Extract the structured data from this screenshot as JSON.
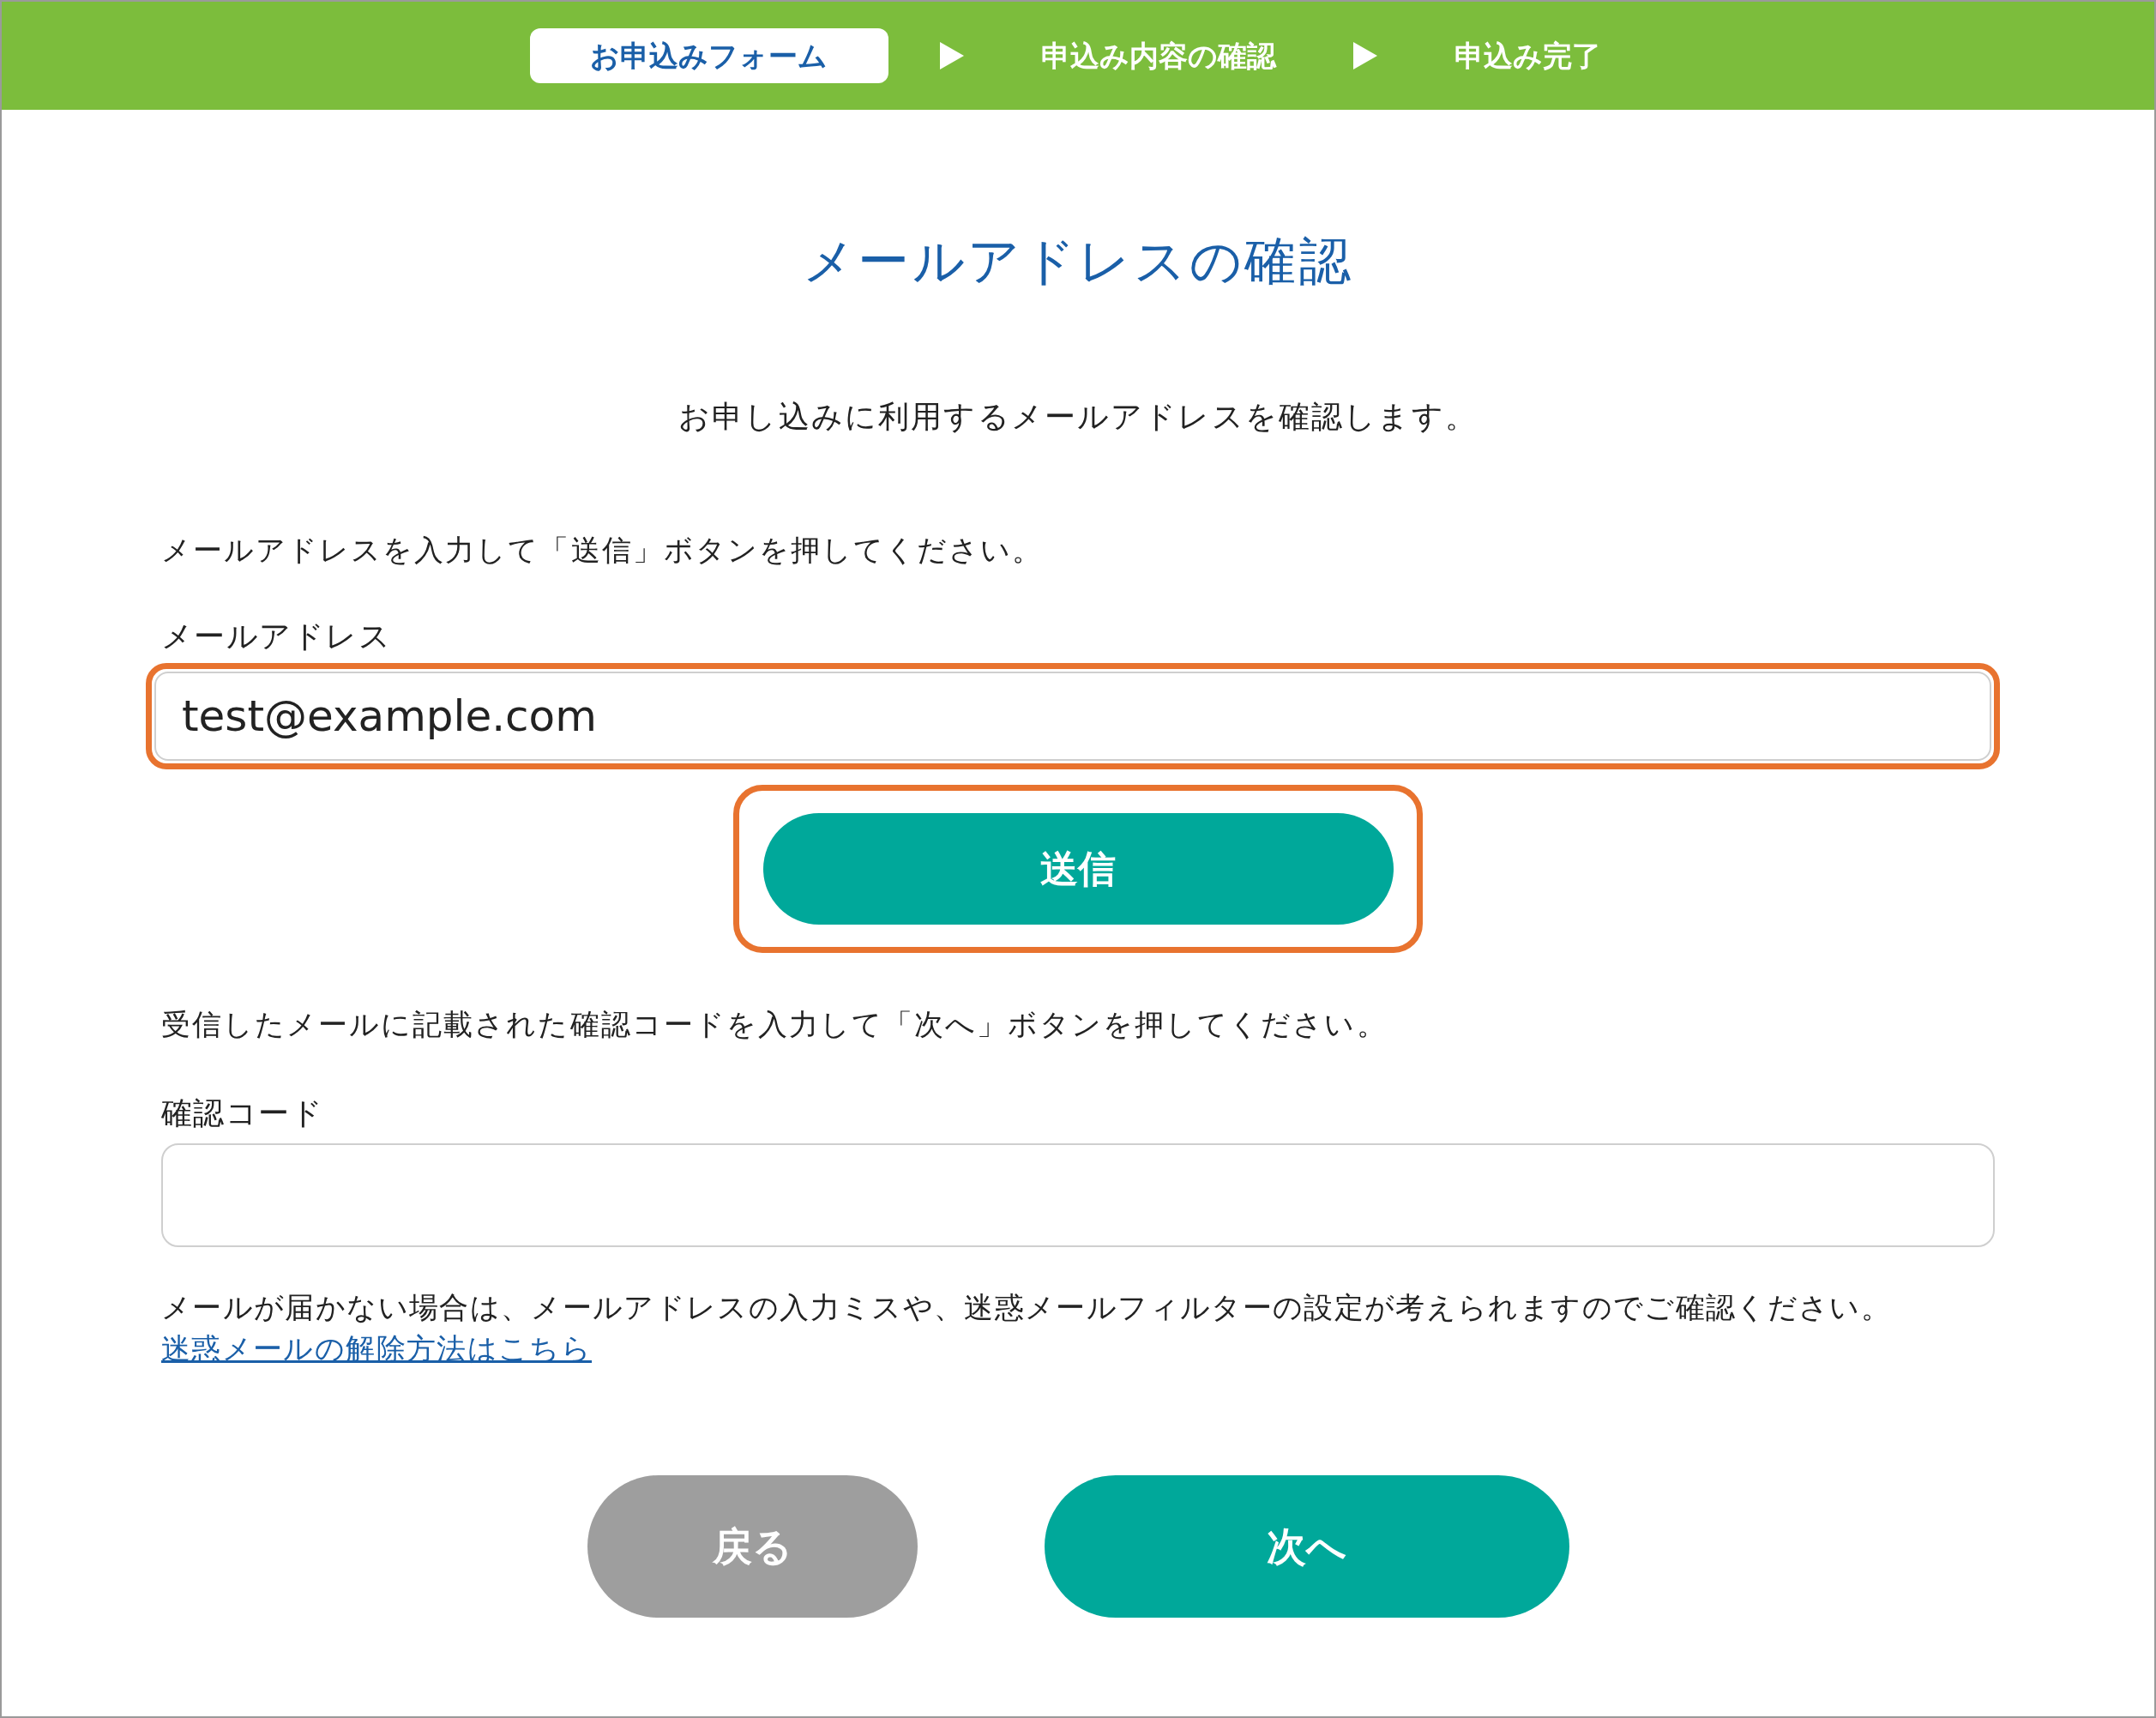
{
  "steps": [
    {
      "label": "お申込みフォーム",
      "selected": true
    },
    {
      "label": "申込み内容の確認",
      "selected": false
    },
    {
      "label": "申込み完了",
      "selected": false
    }
  ],
  "title": "メールアドレスの確認",
  "subtitle": "お申し込みに利用するメールアドレスを確認します。",
  "email_section": {
    "instruction": "メールアドレスを入力して「送信」ボタンを押してください。",
    "label": "メールアドレス",
    "value": "test@example.com",
    "highlighted": true
  },
  "send_button": {
    "label": "送信",
    "highlighted": true
  },
  "code_section": {
    "instruction": "受信したメールに記載された確認コードを入力して「次へ」ボタンを押してください。",
    "label": "確認コード"
  },
  "note": "メールが届かない場合は、メールアドレスの入力ミスや、迷惑メールフィルターの設定が考えられますのでご確認ください。",
  "help_link": "迷惑メールの解除方法はこちら",
  "buttons": [
    {
      "label": "戻る",
      "kind": "back"
    },
    {
      "label": "次へ",
      "kind": "next"
    }
  ]
}
